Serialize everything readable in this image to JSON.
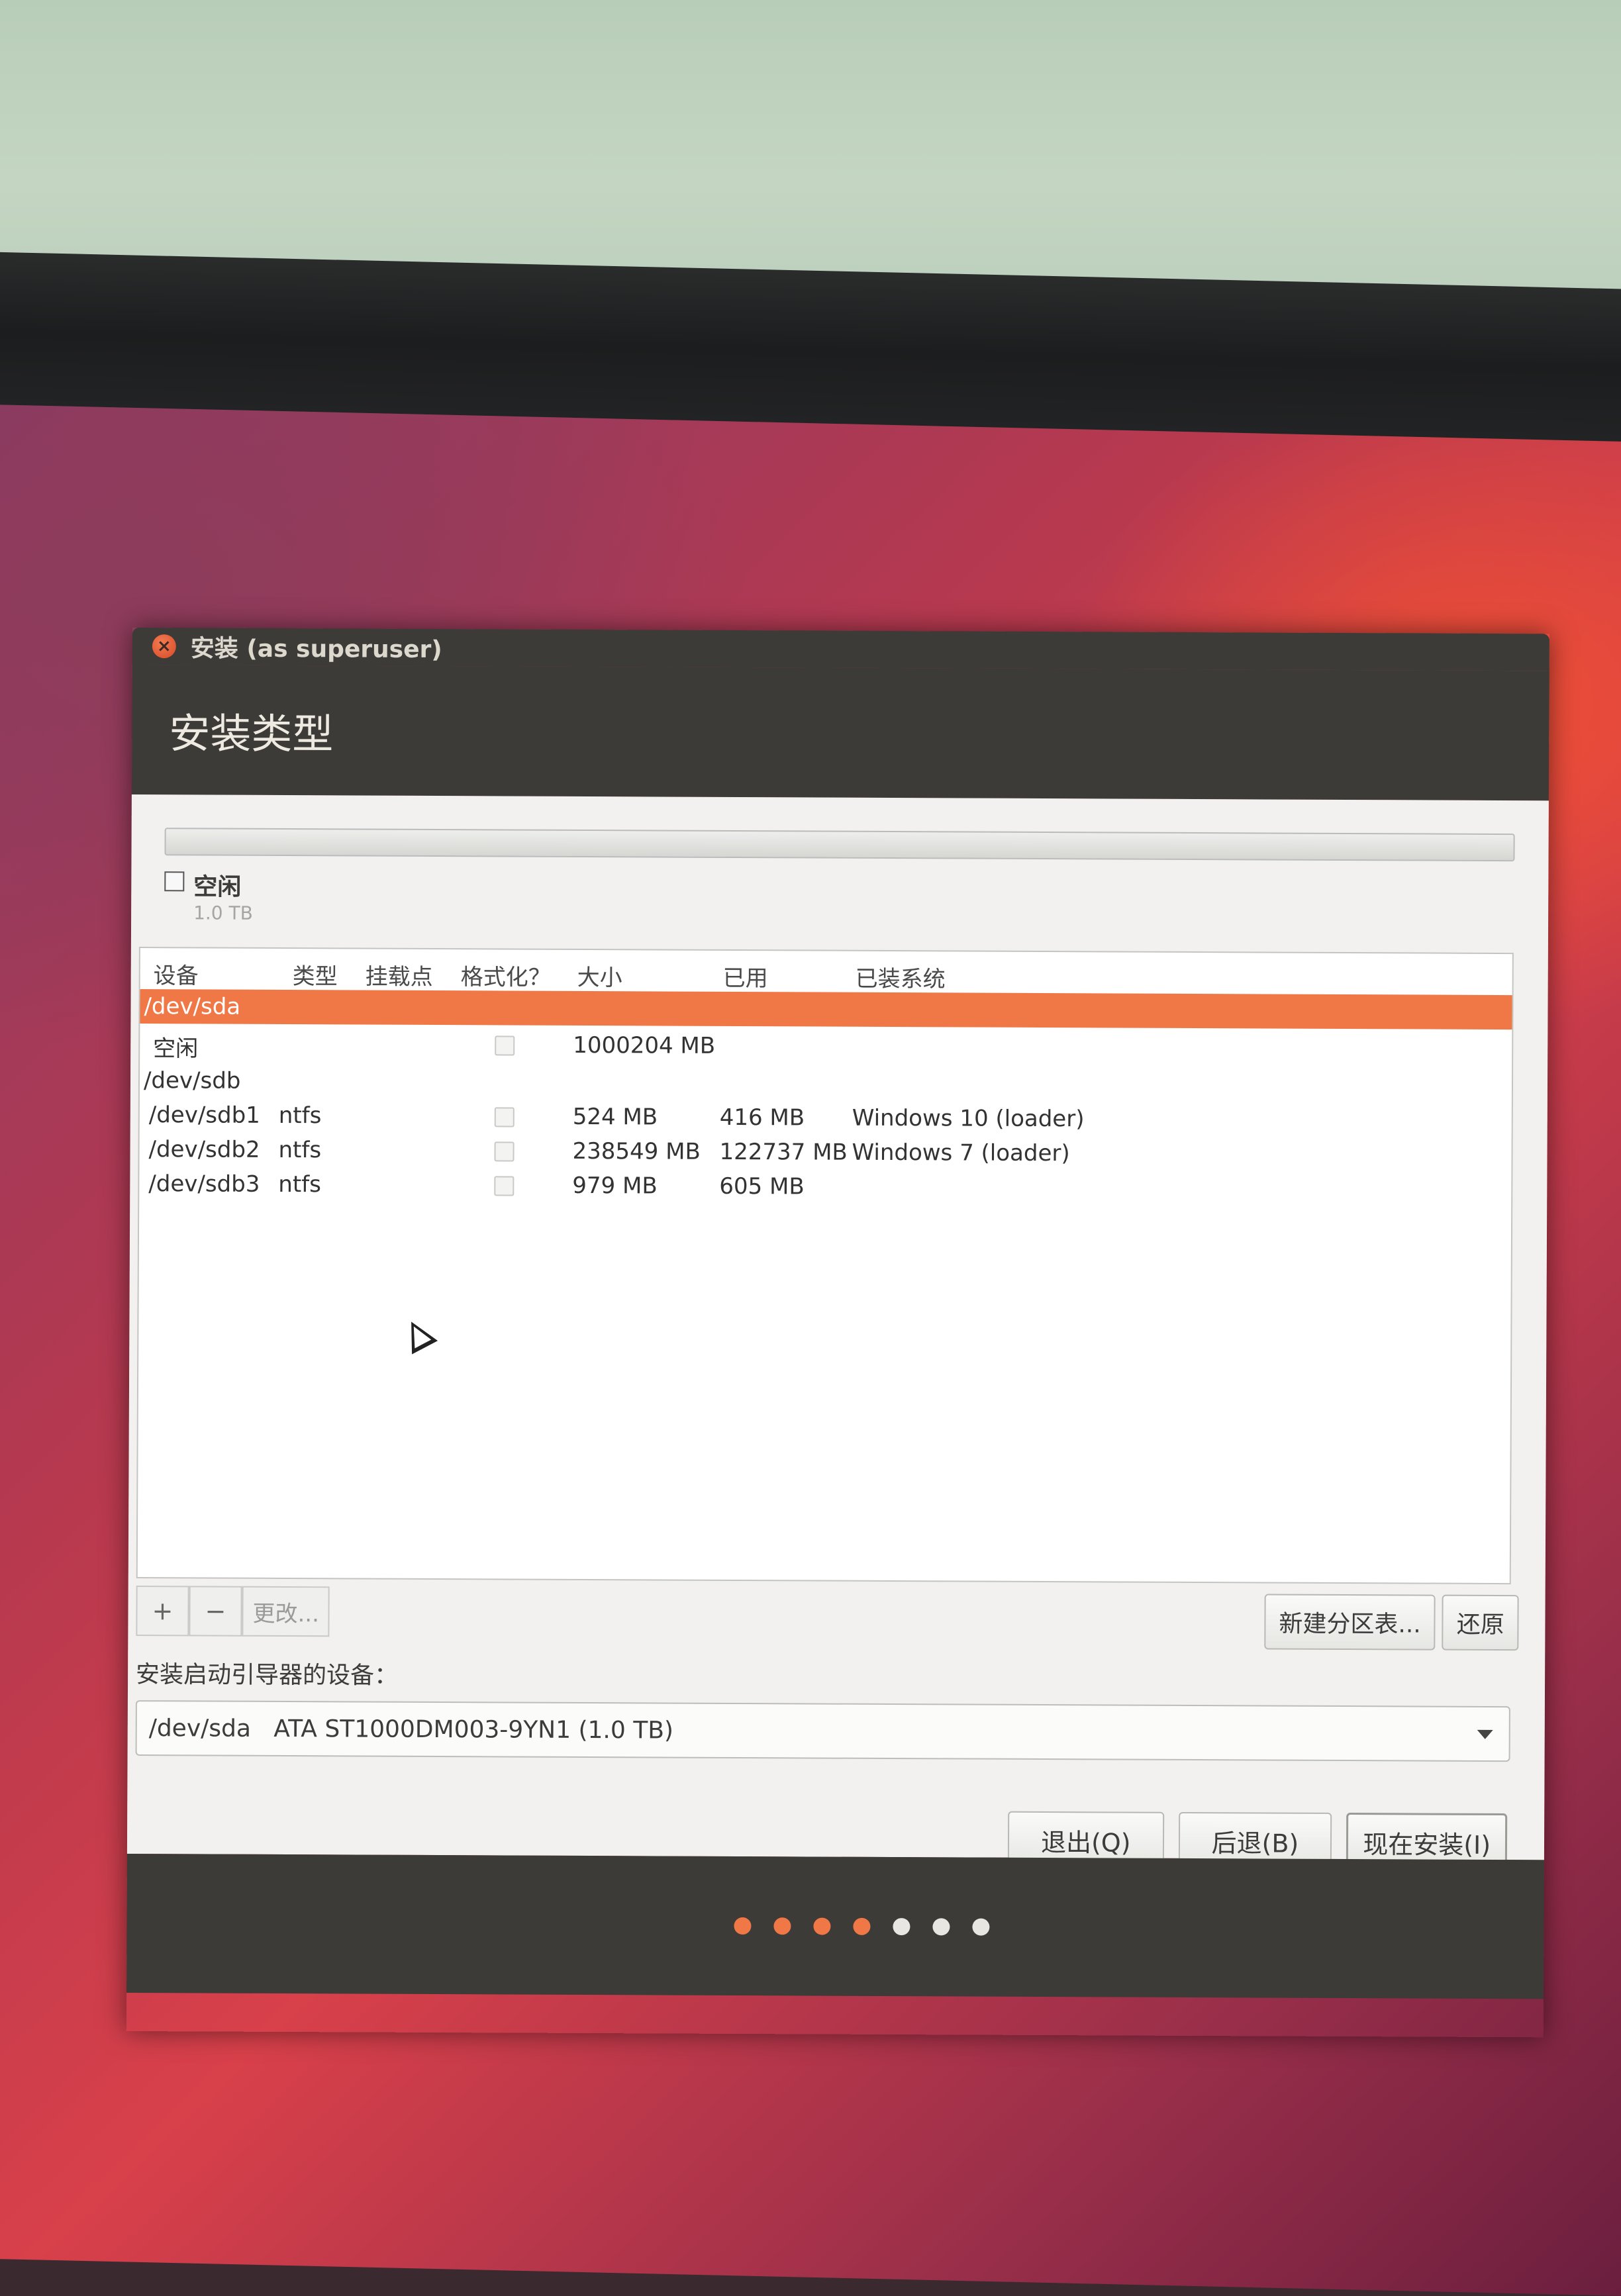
{
  "window": {
    "title": "安装 (as superuser)",
    "close_glyph": "×"
  },
  "header": {
    "title": "安装类型"
  },
  "legend": {
    "label": "空闲",
    "size": "1.0 TB"
  },
  "table": {
    "columns": [
      "设备",
      "类型",
      "挂载点",
      "格式化？",
      "大小",
      "已用",
      "已装系统"
    ],
    "rows": [
      {
        "device": "/dev/sda",
        "type": "",
        "mount": "",
        "format": false,
        "size": "",
        "used": "",
        "system": "",
        "selected": true,
        "show_checkbox": false
      },
      {
        "device": "空闲",
        "type": "",
        "mount": "",
        "format": false,
        "size": "1000204 MB",
        "used": "",
        "system": "",
        "selected": false,
        "show_checkbox": true
      },
      {
        "device": "/dev/sdb",
        "type": "",
        "mount": "",
        "format": false,
        "size": "",
        "used": "",
        "system": "",
        "selected": false,
        "show_checkbox": false
      },
      {
        "device": "/dev/sdb1",
        "type": "ntfs",
        "mount": "",
        "format": false,
        "size": "524 MB",
        "used": "416 MB",
        "system": "Windows 10 (loader)",
        "selected": false,
        "show_checkbox": true
      },
      {
        "device": "/dev/sdb2",
        "type": "ntfs",
        "mount": "",
        "format": false,
        "size": "238549 MB",
        "used": "122737 MB",
        "system": "Windows 7 (loader)",
        "selected": false,
        "show_checkbox": true
      },
      {
        "device": "/dev/sdb3",
        "type": "ntfs",
        "mount": "",
        "format": false,
        "size": "979 MB",
        "used": "605 MB",
        "system": "",
        "selected": false,
        "show_checkbox": true
      }
    ]
  },
  "toolbar": {
    "add": "+",
    "remove": "−",
    "change": "更改..."
  },
  "partition_buttons": {
    "new_table": "新建分区表...",
    "revert": "还原"
  },
  "bootloader": {
    "label": "安装启动引导器的设备：",
    "value": "/dev/sda   ATA ST1000DM003-9YN1 (1.0 TB)"
  },
  "actions": {
    "quit": "退出(Q)",
    "back": "后退(B)",
    "install": "现在安装(I)"
  },
  "progress": {
    "completed_steps": 4,
    "total_steps": 7,
    "active_color": "#f07746",
    "inactive_color": "#e8e6e1"
  }
}
